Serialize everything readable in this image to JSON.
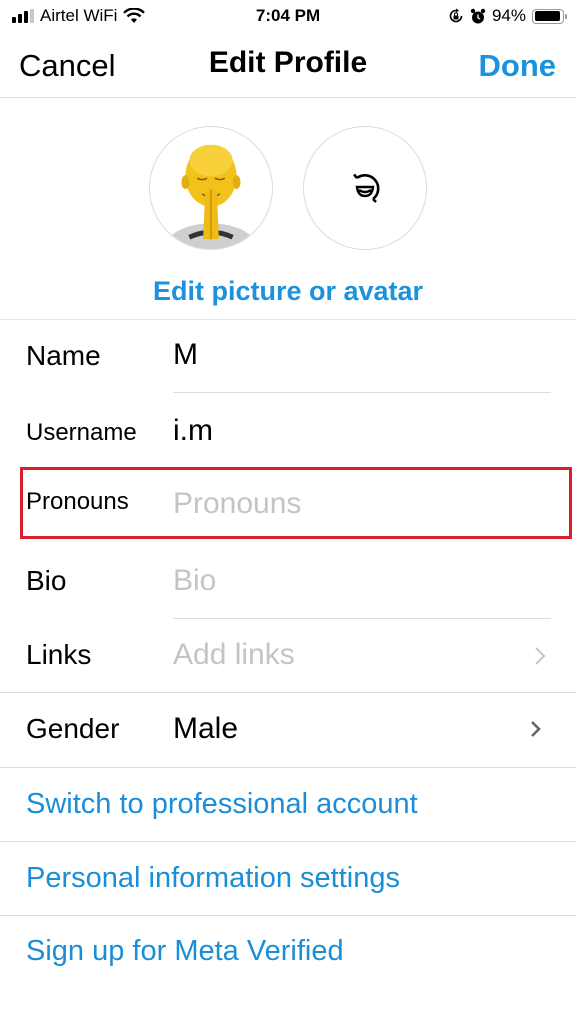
{
  "status_bar": {
    "carrier": "Airtel WiFi",
    "time": "7:04 PM",
    "battery": "94%",
    "battery_level": 0.94,
    "icons": [
      "signal-icon",
      "wifi-icon",
      "orientation-lock-icon",
      "alarm-icon",
      "battery-icon"
    ]
  },
  "nav": {
    "cancel_label": "Cancel",
    "title": "Edit Profile",
    "done_label": "Done"
  },
  "profile": {
    "edit_picture_label": "Edit picture or avatar",
    "photo_icon": "memoji-praying-icon",
    "avatar_icon": "avatar-sticker-icon"
  },
  "fields": [
    {
      "label": "Name",
      "value": "M",
      "placeholder": ""
    },
    {
      "label": "Username",
      "value": "i.m",
      "placeholder": ""
    },
    {
      "label": "Pronouns",
      "value": "",
      "placeholder": "Pronouns"
    },
    {
      "label": "Bio",
      "value": "",
      "placeholder": "Bio"
    },
    {
      "label": "Links",
      "value": "",
      "placeholder": "Add links"
    },
    {
      "label": "Gender",
      "value": "Male",
      "placeholder": ""
    }
  ],
  "links": [
    {
      "label": "Switch to professional account"
    },
    {
      "label": "Personal information settings"
    },
    {
      "label": "Sign up for Meta Verified"
    }
  ],
  "colors": {
    "accent": "#1a93dc",
    "highlight": "#d8202e",
    "placeholder": "#c4c4c4"
  }
}
